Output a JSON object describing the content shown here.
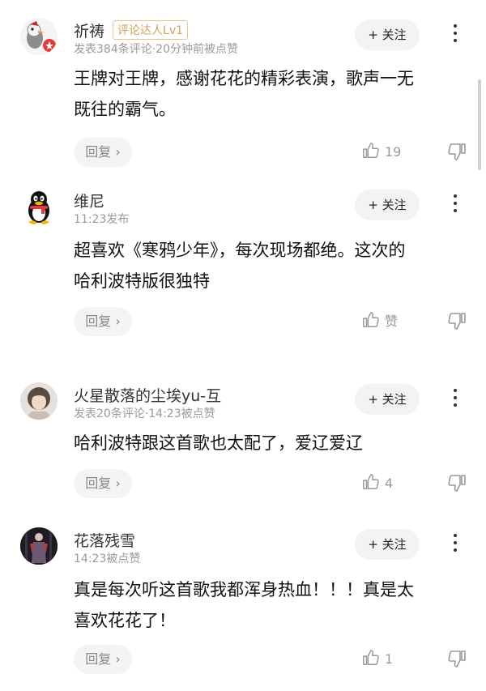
{
  "comments": [
    {
      "username": "祈祷",
      "badge": "评论达人Lv1",
      "meta": "发表384条评论·20分钟前被点赞",
      "follow_label": "+ 关注",
      "text_lines": [
        "王牌对王牌，感谢花花的精彩表演，歌声一无",
        "既往的霸气。"
      ],
      "reply_label": "回复 ›",
      "like_label": "19",
      "avatar_icon": "cartoon-bird-avatar"
    },
    {
      "username": "维尼",
      "meta": "11:23发布",
      "follow_label": "+ 关注",
      "text_lines": [
        "超喜欢《寒鸦少年》，每次现场都绝。这次的",
        "哈利波特版很独特"
      ],
      "reply_label": "回复 ›",
      "like_label": "赞",
      "avatar_icon": "qq-penguin-avatar"
    },
    {
      "username": "火星散落的尘埃yu-互",
      "meta": "发表20条评论·14:23被点赞",
      "follow_label": "+ 关注",
      "text_lines": [
        "哈利波特跟这首歌也太配了，爱辽爱辽"
      ],
      "reply_label": "回复 ›",
      "like_label": "4",
      "avatar_icon": "person-photo-avatar"
    },
    {
      "username": "花落残雪",
      "meta": "14:23被点赞",
      "follow_label": "+ 关注",
      "text_lines": [
        "真是每次听这首歌我都浑身热血！！！真是太",
        "喜欢花花了！"
      ],
      "reply_label": "回复 ›",
      "like_label": "1",
      "avatar_icon": "stage-photo-avatar"
    }
  ],
  "colors": {
    "badge": "#d1a35a",
    "meta": "#999999",
    "pill_bg": "#f3f3f3"
  }
}
